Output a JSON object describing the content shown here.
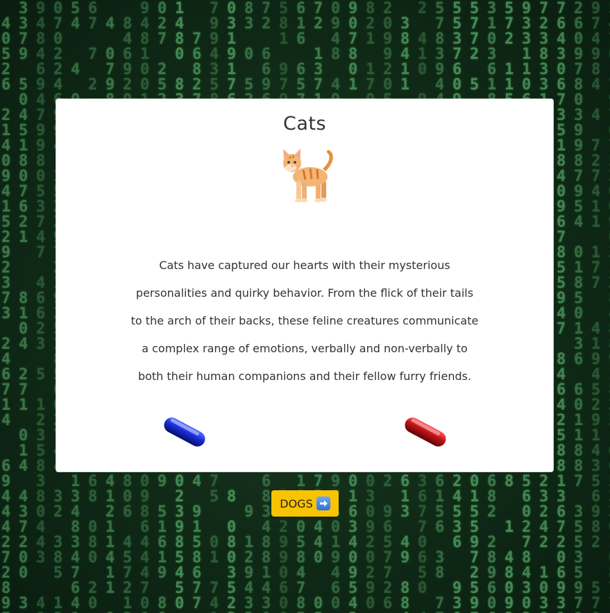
{
  "card": {
    "title": "Cats",
    "illustration": "cat-emoji",
    "body": "Cats have captured our hearts with their mysterious personalities and quirky behavior. From the flick of their tails to the arch of their backs, these feline creatures communicate a complex range of emotions, verbally and non-verbally to both their human companions and their fellow furry friends.",
    "pills": [
      {
        "name": "blue-pill",
        "color": "#1a2fd6"
      },
      {
        "name": "red-pill",
        "color": "#c0141a"
      }
    ]
  },
  "nav": {
    "next_label": "DOGS",
    "next_icon": "right-arrow-icon",
    "button_color": "#f8c300"
  },
  "background": {
    "style": "matrix-digital-rain",
    "glyph_color": "#5fae6f"
  }
}
